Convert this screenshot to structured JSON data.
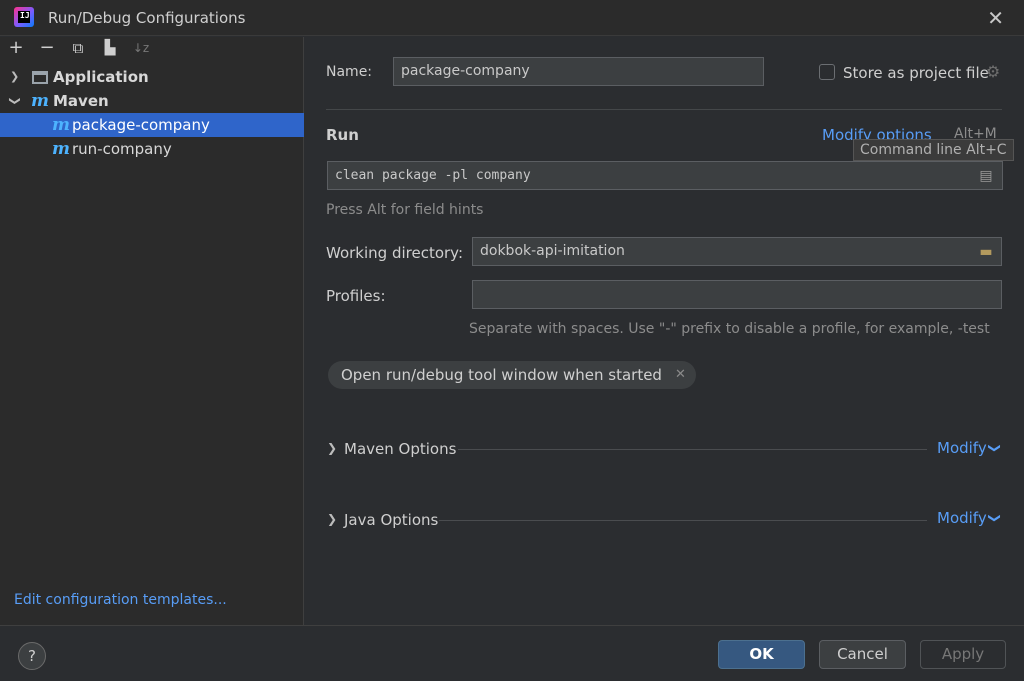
{
  "window": {
    "title": "Run/Debug Configurations",
    "app_icon": "intellij-icon",
    "close_icon": "close-icon"
  },
  "toolbar": {
    "add": "+",
    "remove": "−",
    "copy": "⧉",
    "new_folder": "▙",
    "sort": "↓z"
  },
  "tree": {
    "items": [
      {
        "label": "Application",
        "level": 0,
        "expanded": false,
        "icon": "application-icon"
      },
      {
        "label": "Maven",
        "level": 0,
        "expanded": true,
        "icon": "maven-icon"
      },
      {
        "label": "package-company",
        "level": 1,
        "selected": true,
        "icon": "maven-icon"
      },
      {
        "label": "run-company",
        "level": 1,
        "selected": false,
        "icon": "maven-icon"
      }
    ],
    "maven_glyph": "m",
    "arrow_collapsed": "❯",
    "arrow_expanded": "❯"
  },
  "left_footer": {
    "edit_templates": "Edit configuration templates..."
  },
  "form": {
    "name_label": "Name:",
    "name_value": "package-company",
    "store_label": "Store as project file",
    "store_checked": false,
    "run_heading": "Run",
    "modify_options": "Modify options",
    "modify_shortcut": "Alt+M",
    "tooltip": "Command line Alt+C",
    "command_value": "clean package -pl company",
    "field_hint": "Press Alt for field hints",
    "workdir_label": "Working directory:",
    "workdir_value": "dokbok-api-imitation",
    "profiles_label": "Profiles:",
    "profiles_value": "",
    "profiles_hint": "Separate with spaces. Use \"-\" prefix to disable a profile, for example, -test",
    "tag_label": "Open run/debug tool window when started",
    "maven_options": "Maven Options",
    "java_options": "Java Options",
    "modify": "Modify"
  },
  "footer": {
    "help": "?",
    "ok": "OK",
    "cancel": "Cancel",
    "apply": "Apply"
  },
  "colors": {
    "accent": "#589df6",
    "selection": "#2f65ca",
    "ok_button": "#365880"
  }
}
